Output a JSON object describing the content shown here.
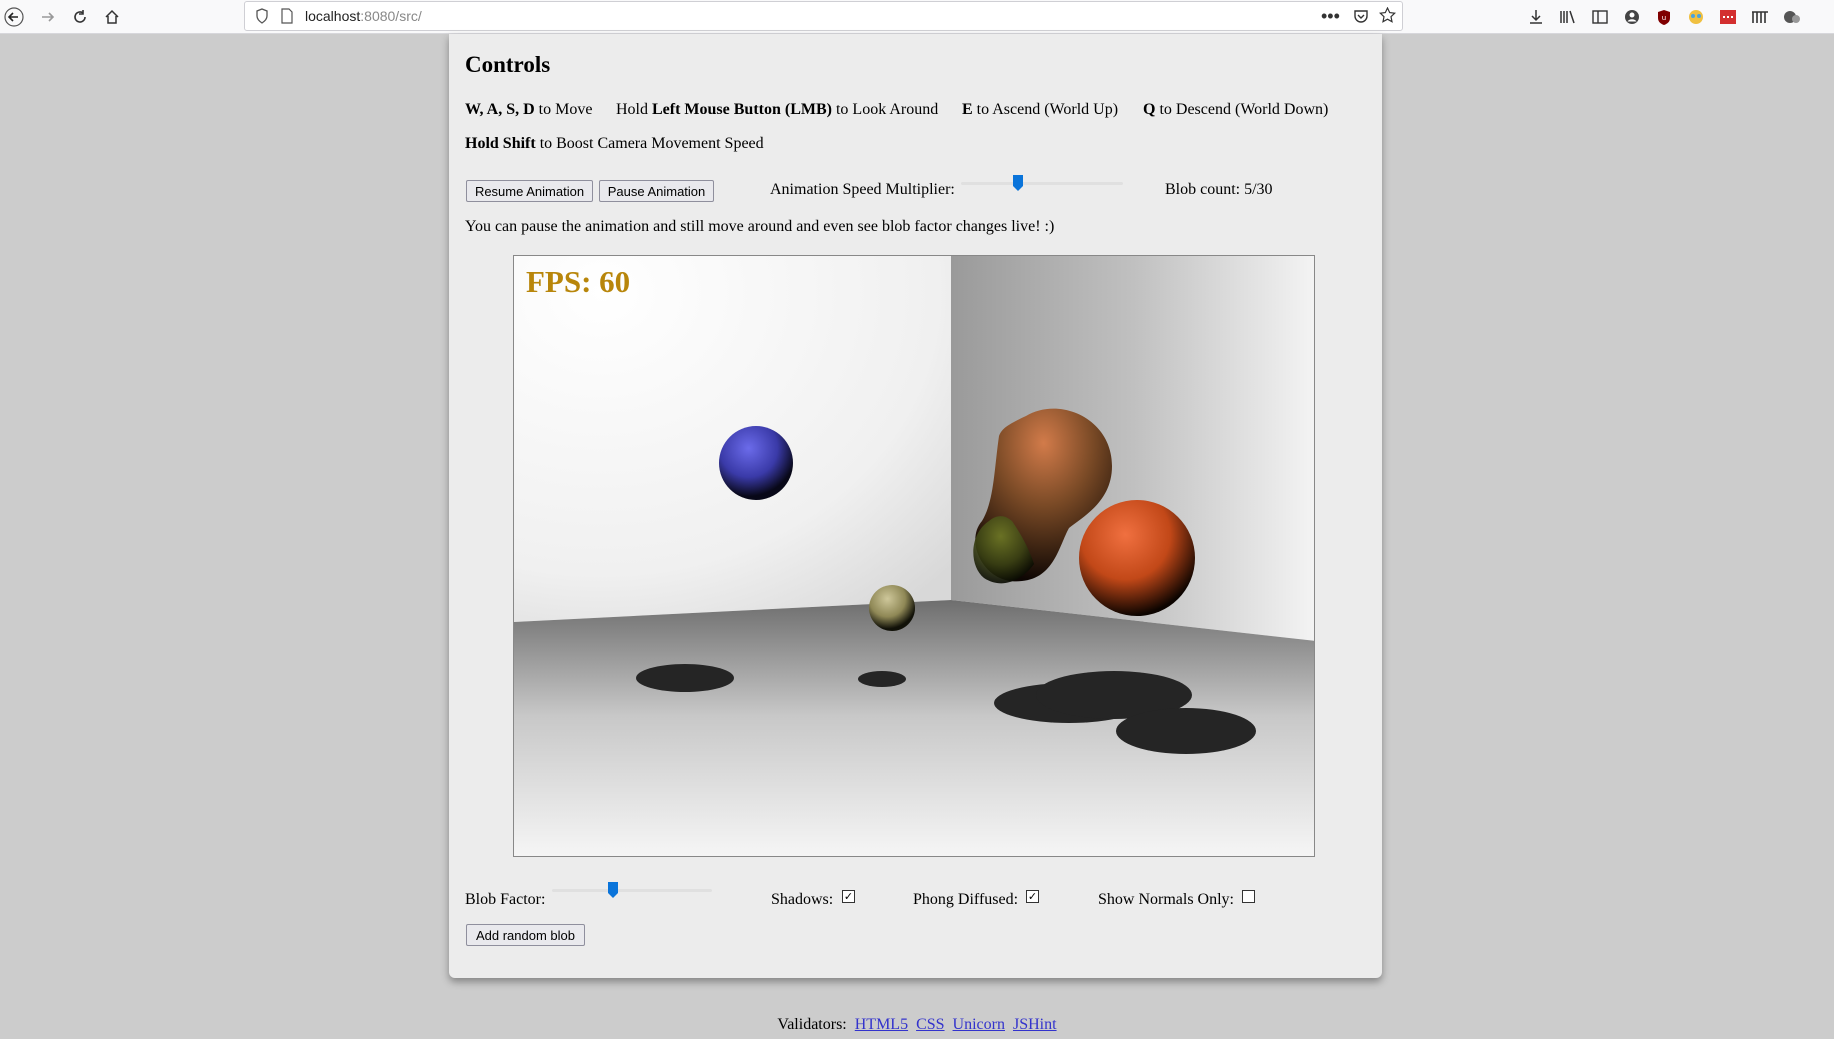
{
  "browser": {
    "url_host": "localhost",
    "url_path": ":8080/src/"
  },
  "controls": {
    "title": "Controls",
    "move_keys": "W, A, S, D",
    "move_text": " to Move",
    "look_prefix": "Hold ",
    "look_keys": "Left Mouse Button (LMB)",
    "look_text": " to Look Around",
    "ascend_key": "E",
    "ascend_text": " to Ascend (World Up)",
    "descend_key": "Q",
    "descend_text": " to Descend (World Down)",
    "boost_key": "Hold Shift",
    "boost_text": " to Boost Camera Movement Speed",
    "resume_label": "Resume Animation",
    "pause_label": "Pause Animation",
    "speed_label": "Animation Speed Multiplier:",
    "speed_value": 0.34,
    "blob_count_label": "Blob count: 5/30",
    "hint": "You can pause the animation and still move around and even see blob factor changes live! :)"
  },
  "scene": {
    "fps_label": "FPS: 60"
  },
  "options": {
    "blob_factor_label": "Blob Factor:",
    "blob_factor_value": 0.37,
    "shadows_label": "Shadows:",
    "shadows_checked": true,
    "phong_label": "Phong Diffused:",
    "phong_checked": true,
    "normals_label": "Show Normals Only:",
    "normals_checked": false,
    "add_blob_label": "Add random blob"
  },
  "footer": {
    "validators_label": "Validators:",
    "links": [
      "HTML5",
      "CSS",
      "Unicorn",
      "JSHint"
    ]
  },
  "colors": {
    "fps": "#b8860b",
    "accent": "#0a74da"
  }
}
